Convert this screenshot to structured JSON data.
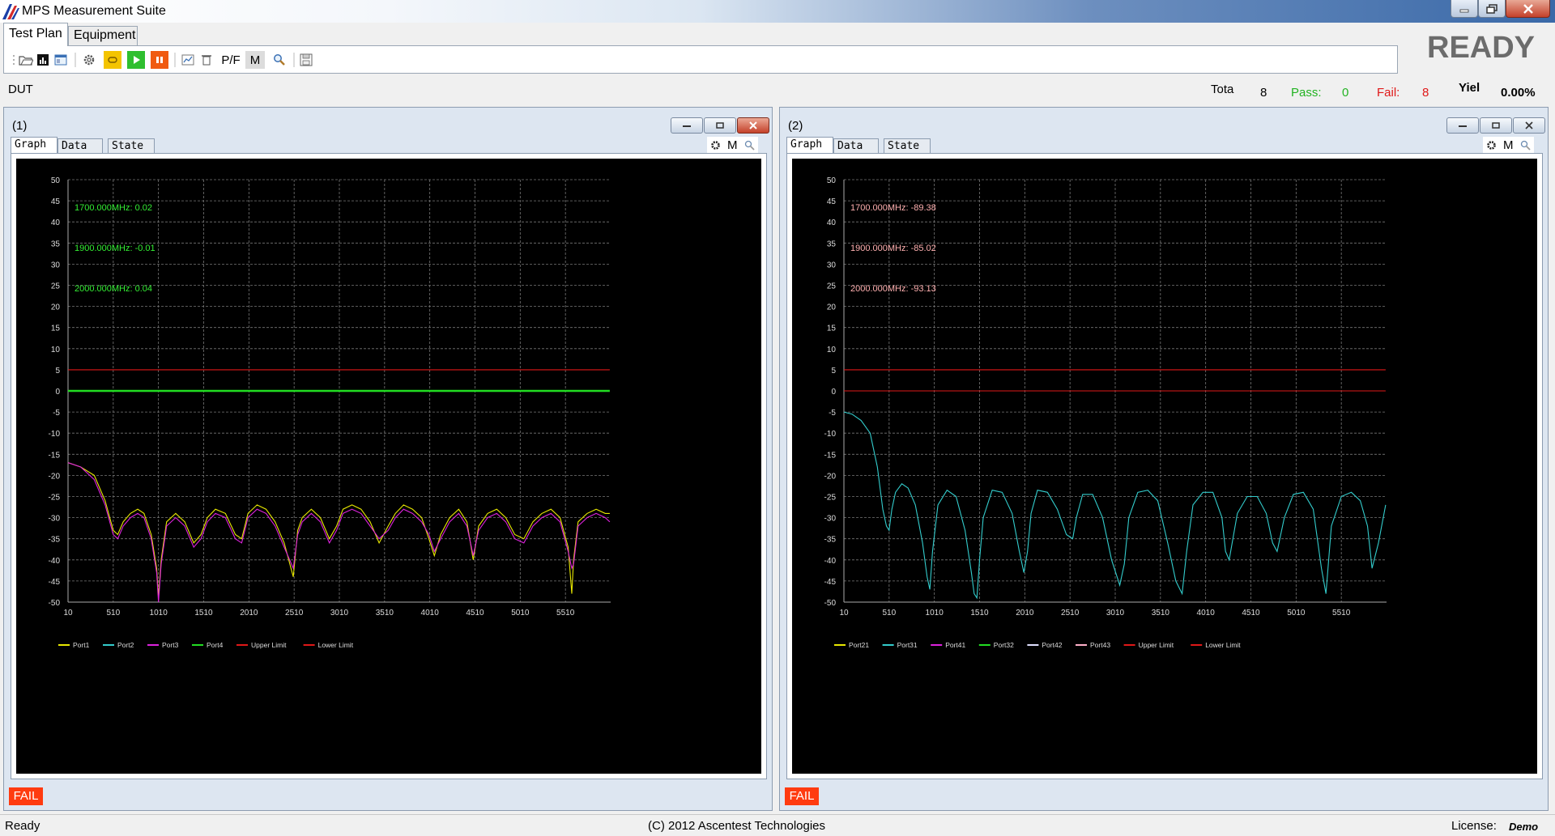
{
  "window": {
    "title": "MPS Measurement Suite"
  },
  "tabs": [
    {
      "label": "Test Plan"
    },
    {
      "label": "Equipment"
    }
  ],
  "toolbar": {
    "pf_label": "P/F",
    "m_label": "M"
  },
  "status_big": "READY",
  "dut_label": "DUT",
  "stats": {
    "total_label": "Tota",
    "total_value": "8",
    "pass_label": "Pass:",
    "pass_value": "0",
    "fail_label": "Fail:",
    "fail_value": "8",
    "yield_label": "Yiel",
    "yield_value": "0.00%"
  },
  "colors": {
    "pass": "#22b322",
    "fail": "#e01818"
  },
  "panels": [
    {
      "title": "(1)",
      "subtabs": [
        "Graph",
        "Data",
        "State"
      ],
      "tools_m": "M",
      "result": "FAIL",
      "chart_data": {
        "type": "line",
        "xlabel": "",
        "ylabel": "",
        "xlim": [
          10,
          6010
        ],
        "ylim": [
          -50,
          50
        ],
        "x_ticks": [
          10,
          510,
          1010,
          1510,
          2010,
          2510,
          3010,
          3510,
          4010,
          4510,
          5010,
          5510
        ],
        "y_ticks": [
          50,
          45,
          40,
          35,
          30,
          25,
          20,
          15,
          10,
          5,
          0,
          -5,
          -10,
          -15,
          -20,
          -25,
          -30,
          -35,
          -40,
          -45,
          -50
        ],
        "grid": true,
        "legend_placement": "bottom-left",
        "markers": [
          {
            "text": "1700.000MHz: 0.02",
            "color": "#33ee33"
          },
          {
            "text": "1900.000MHz: -0.01",
            "color": "#33ee33"
          },
          {
            "text": "2000.000MHz: 0.04",
            "color": "#33ee33"
          }
        ],
        "legend": [
          {
            "name": "Port1",
            "color": "#e8e800"
          },
          {
            "name": "Port2",
            "color": "#33cccc"
          },
          {
            "name": "Port3",
            "color": "#dd22dd"
          },
          {
            "name": "Port4",
            "color": "#22dd22"
          },
          {
            "name": "Upper Limit",
            "color": "#e01818"
          },
          {
            "name": "Lower Limit",
            "color": "#e01818"
          }
        ],
        "series": [
          {
            "name": "Port1",
            "color": "#e8e800",
            "x": [
              10,
              150,
              300,
              420,
              510,
              560,
              620,
              700,
              780,
              850,
              930,
              990,
              1010,
              1040,
              1100,
              1200,
              1300,
              1400,
              1480,
              1550,
              1640,
              1750,
              1860,
              1930,
              2000,
              2100,
              2200,
              2300,
              2400,
              2500,
              2550,
              2600,
              2700,
              2800,
              2900,
              2980,
              3050,
              3150,
              3250,
              3350,
              3450,
              3550,
              3630,
              3720,
              3820,
              3920,
              4000,
              4060,
              4130,
              4230,
              4330,
              4420,
              4490,
              4550,
              4650,
              4750,
              4850,
              4950,
              5050,
              5150,
              5250,
              5350,
              5450,
              5540,
              5580,
              5600,
              5650,
              5750,
              5850,
              5950,
              6000
            ],
            "y": [
              -17,
              -18,
              -20,
              -26,
              -33,
              -34,
              -31,
              -29,
              -28,
              -29,
              -34,
              -42,
              -49,
              -40,
              -31,
              -29,
              -31,
              -36,
              -34,
              -30,
              -28,
              -29,
              -34,
              -35,
              -29,
              -27,
              -28,
              -31,
              -36,
              -44,
              -33,
              -30,
              -28,
              -30,
              -35,
              -32,
              -28,
              -27,
              -28,
              -31,
              -36,
              -32,
              -29,
              -27,
              -28,
              -30,
              -35,
              -39,
              -34,
              -30,
              -28,
              -31,
              -40,
              -32,
              -29,
              -28,
              -30,
              -34,
              -35,
              -31,
              -29,
              -28,
              -30,
              -37,
              -48,
              -40,
              -31,
              -29,
              -28,
              -29,
              -29
            ]
          },
          {
            "name": "Port3",
            "color": "#dd22dd",
            "x": [
              10,
              150,
              300,
              420,
              510,
              560,
              620,
              700,
              780,
              850,
              930,
              990,
              1010,
              1040,
              1100,
              1200,
              1300,
              1400,
              1480,
              1550,
              1640,
              1750,
              1860,
              1930,
              2000,
              2100,
              2200,
              2300,
              2400,
              2500,
              2550,
              2600,
              2700,
              2800,
              2900,
              2980,
              3050,
              3150,
              3250,
              3350,
              3450,
              3550,
              3630,
              3720,
              3820,
              3920,
              4000,
              4060,
              4130,
              4230,
              4330,
              4420,
              4490,
              4550,
              4650,
              4750,
              4850,
              4950,
              5050,
              5150,
              5250,
              5350,
              5450,
              5540,
              5580,
              5600,
              5650,
              5750,
              5850,
              5950,
              6000
            ],
            "y": [
              -17,
              -18,
              -21,
              -27,
              -34,
              -35,
              -32,
              -30,
              -29,
              -30,
              -35,
              -43,
              -50,
              -41,
              -32,
              -30,
              -32,
              -37,
              -35,
              -31,
              -29,
              -30,
              -35,
              -36,
              -30,
              -28,
              -29,
              -32,
              -37,
              -42,
              -34,
              -31,
              -29,
              -31,
              -36,
              -33,
              -29,
              -28,
              -29,
              -32,
              -35,
              -33,
              -30,
              -28,
              -29,
              -31,
              -34,
              -38,
              -35,
              -31,
              -29,
              -32,
              -39,
              -33,
              -30,
              -29,
              -31,
              -35,
              -36,
              -32,
              -30,
              -29,
              -31,
              -38,
              -42,
              -41,
              -32,
              -30,
              -29,
              -30,
              -31
            ]
          },
          {
            "name": "Port4",
            "color": "#22dd22",
            "x": [
              10,
              6000
            ],
            "y": [
              0,
              0
            ]
          },
          {
            "name": "Upper Limit",
            "color": "#e01818",
            "x": [
              10,
              6000
            ],
            "y": [
              5,
              5
            ]
          }
        ]
      }
    },
    {
      "title": "(2)",
      "subtabs": [
        "Graph",
        "Data",
        "State"
      ],
      "tools_m": "M",
      "result": "FAIL",
      "chart_data": {
        "type": "line",
        "xlabel": "",
        "ylabel": "",
        "xlim": [
          10,
          6010
        ],
        "ylim": [
          -50,
          50
        ],
        "x_ticks": [
          10,
          510,
          1010,
          1510,
          2010,
          2510,
          3010,
          3510,
          4010,
          4510,
          5010,
          5510
        ],
        "y_ticks": [
          50,
          45,
          40,
          35,
          30,
          25,
          20,
          15,
          10,
          5,
          0,
          -5,
          -10,
          -15,
          -20,
          -25,
          -30,
          -35,
          -40,
          -45,
          -50
        ],
        "grid": true,
        "legend_placement": "bottom-left",
        "markers": [
          {
            "text": "1700.000MHz: -89.38",
            "color": "#ffb0b0"
          },
          {
            "text": "1900.000MHz: -85.02",
            "color": "#ffb0b0"
          },
          {
            "text": "2000.000MHz: -93.13",
            "color": "#ffb0b0"
          }
        ],
        "legend": [
          {
            "name": "Port21",
            "color": "#e8e800"
          },
          {
            "name": "Port31",
            "color": "#33cccc"
          },
          {
            "name": "Port41",
            "color": "#dd22dd"
          },
          {
            "name": "Port32",
            "color": "#22dd22"
          },
          {
            "name": "Port42",
            "color": "#e0e0ff"
          },
          {
            "name": "Port43",
            "color": "#ffb0c8"
          },
          {
            "name": "Upper Limit",
            "color": "#e01818"
          },
          {
            "name": "Lower Limit",
            "color": "#e01818"
          }
        ],
        "series": [
          {
            "name": "Port31",
            "color": "#33cccc",
            "x": [
              10,
              100,
              200,
              300,
              380,
              440,
              480,
              510,
              540,
              580,
              650,
              720,
              800,
              880,
              930,
              960,
              990,
              1050,
              1150,
              1250,
              1350,
              1420,
              1450,
              1480,
              1510,
              1550,
              1650,
              1760,
              1870,
              1950,
              2000,
              2040,
              2080,
              2150,
              2260,
              2370,
              2470,
              2540,
              2580,
              2650,
              2760,
              2870,
              2970,
              3060,
              3110,
              3160,
              3260,
              3370,
              3480,
              3590,
              3680,
              3750,
              3800,
              3870,
              3980,
              4090,
              4190,
              4230,
              4270,
              4360,
              4470,
              4580,
              4680,
              4750,
              4800,
              4880,
              4980,
              5090,
              5200,
              5290,
              5340,
              5400,
              5510,
              5620,
              5720,
              5800,
              5850,
              5920,
              6000
            ],
            "y": [
              -5,
              -5.5,
              -7,
              -10,
              -18,
              -28,
              -32,
              -33,
              -28,
              -24,
              -22,
              -23,
              -27,
              -36,
              -44,
              -47,
              -38,
              -27,
              -23.5,
              -25,
              -33,
              -43,
              -48,
              -49,
              -40,
              -30,
              -23.5,
              -24,
              -29,
              -38,
              -43,
              -38,
              -29,
              -23.5,
              -24,
              -28,
              -34,
              -35,
              -30,
              -24.5,
              -24.5,
              -30,
              -40,
              -46,
              -41,
              -30,
              -24,
              -23.5,
              -26,
              -36,
              -45,
              -48,
              -38,
              -27,
              -24,
              -24,
              -30,
              -38,
              -40,
              -29,
              -25,
              -25,
              -29,
              -36,
              -38,
              -30,
              -24.5,
              -24,
              -28,
              -42,
              -48,
              -32,
              -25,
              -24,
              -26,
              -32,
              -42,
              -36,
              -27
            ]
          },
          {
            "name": "Upper Limit",
            "color": "#e01818",
            "x": [
              10,
              6000
            ],
            "y": [
              5,
              5
            ]
          },
          {
            "name": "Lower Limit",
            "color": "#e01818",
            "x": [
              10,
              6000
            ],
            "y": [
              0,
              0
            ]
          }
        ]
      }
    }
  ],
  "statusbar": {
    "left": "Ready",
    "center": "(C) 2012 Ascentest Technologies",
    "license_label": "License:",
    "license_value": "Demo"
  }
}
